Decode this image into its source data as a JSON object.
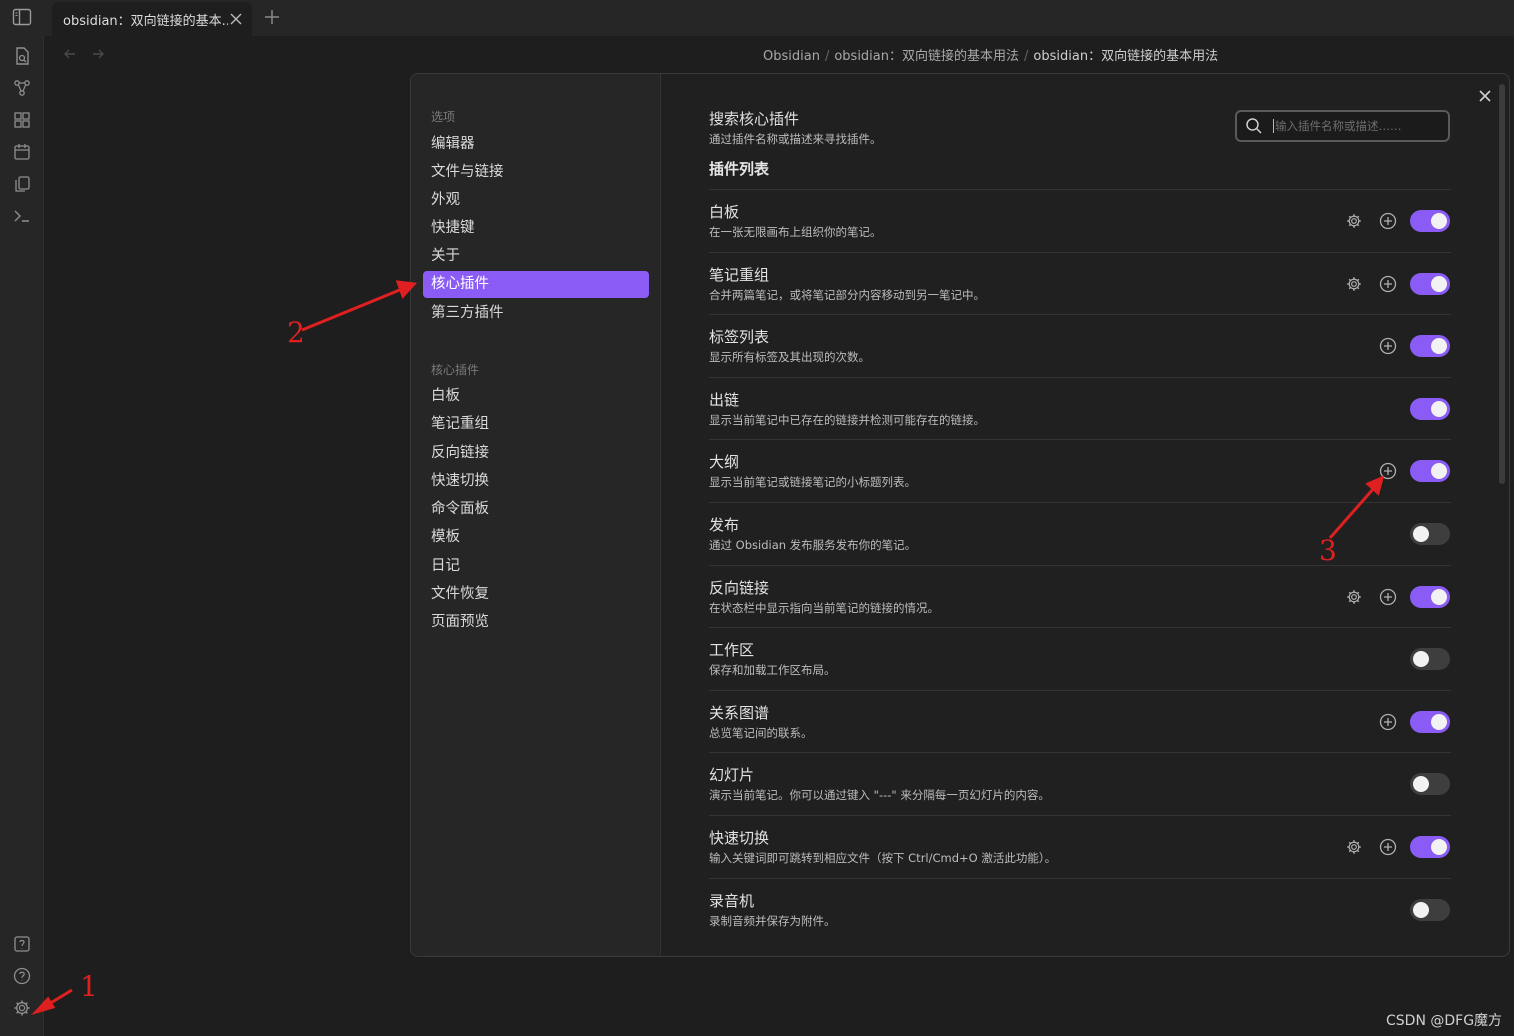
{
  "tab": {
    "title": "obsidian：双向链接的基本..."
  },
  "breadcrumb": [
    "Obsidian",
    "obsidian：双向链接的基本用法",
    "obsidian：双向链接的基本用法"
  ],
  "modal": {
    "options_heading": "选项",
    "options": [
      {
        "label": "编辑器"
      },
      {
        "label": "文件与链接"
      },
      {
        "label": "外观"
      },
      {
        "label": "快捷键"
      },
      {
        "label": "关于"
      },
      {
        "label": "核心插件",
        "active": true
      },
      {
        "label": "第三方插件"
      }
    ],
    "core_heading": "核心插件",
    "core_items": [
      "白板",
      "笔记重组",
      "反向链接",
      "快速切换",
      "命令面板",
      "模板",
      "日记",
      "文件恢复",
      "页面预览"
    ],
    "search": {
      "title": "搜索核心插件",
      "desc": "通过插件名称或描述来寻找插件。",
      "placeholder": "输入插件名称或描述……"
    },
    "list_heading": "插件列表",
    "plugins": [
      {
        "name": "白板",
        "desc": "在一张无限画布上组织你的笔记。",
        "gear": true,
        "plus": true,
        "enabled": true
      },
      {
        "name": "笔记重组",
        "desc": "合并两篇笔记，或将笔记部分内容移动到另一笔记中。",
        "gear": true,
        "plus": true,
        "enabled": true
      },
      {
        "name": "标签列表",
        "desc": "显示所有标签及其出现的次数。",
        "gear": false,
        "plus": true,
        "enabled": true
      },
      {
        "name": "出链",
        "desc": "显示当前笔记中已存在的链接并检测可能存在的链接。",
        "gear": false,
        "plus": false,
        "enabled": true
      },
      {
        "name": "大纲",
        "desc": "显示当前笔记或链接笔记的小标题列表。",
        "gear": false,
        "plus": true,
        "enabled": true
      },
      {
        "name": "发布",
        "desc": "通过 Obsidian 发布服务发布你的笔记。",
        "gear": false,
        "plus": false,
        "enabled": false
      },
      {
        "name": "反向链接",
        "desc": "在状态栏中显示指向当前笔记的链接的情况。",
        "gear": true,
        "plus": true,
        "enabled": true
      },
      {
        "name": "工作区",
        "desc": "保存和加载工作区布局。",
        "gear": false,
        "plus": false,
        "enabled": false
      },
      {
        "name": "关系图谱",
        "desc": "总览笔记间的联系。",
        "gear": false,
        "plus": true,
        "enabled": true
      },
      {
        "name": "幻灯片",
        "desc": "演示当前笔记。你可以通过键入 \"---\" 来分隔每一页幻灯片的内容。",
        "gear": false,
        "plus": false,
        "enabled": false
      },
      {
        "name": "快速切换",
        "desc": "输入关键词即可跳转到相应文件（按下 Ctrl/Cmd+O 激活此功能）。",
        "gear": true,
        "plus": true,
        "enabled": true
      },
      {
        "name": "录音机",
        "desc": "录制音频并保存为附件。",
        "gear": false,
        "plus": false,
        "enabled": false
      }
    ]
  },
  "annotations": [
    "1",
    "2",
    "3"
  ],
  "watermark": "CSDN @DFG魔方",
  "colors": {
    "accent": "#8a5cf5",
    "annotation": "#e02020"
  }
}
